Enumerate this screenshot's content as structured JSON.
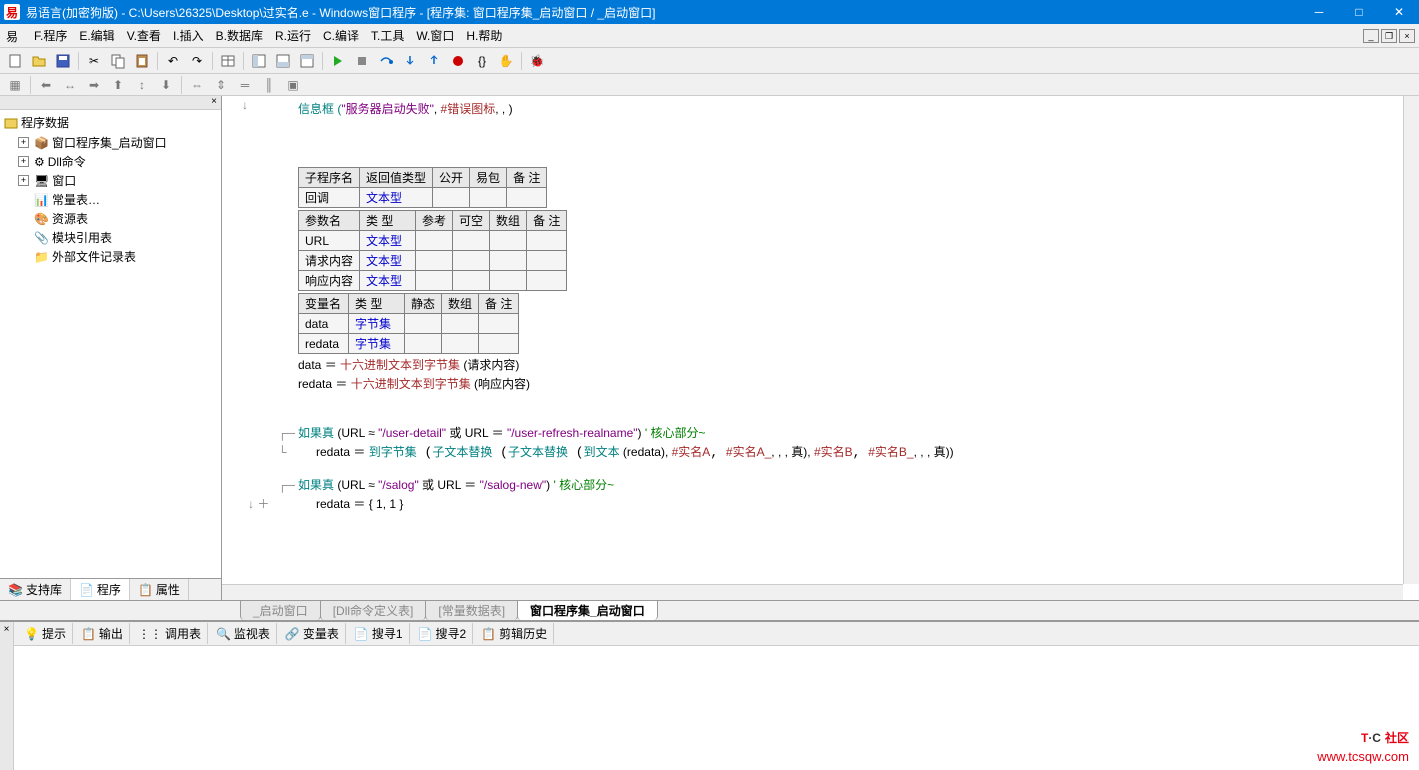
{
  "title": "易语言(加密狗版) - C:\\Users\\26325\\Desktop\\过实名.e - Windows窗口程序 - [程序集: 窗口程序集_启动窗口 / _启动窗口]",
  "logo_char": "易",
  "menu": {
    "file": "F.程序",
    "edit": "E.编辑",
    "view": "V.查看",
    "insert": "I.插入",
    "db": "B.数据库",
    "run": "R.运行",
    "compile": "C.编译",
    "tool": "T.工具",
    "window": "W.窗口",
    "help": "H.帮助"
  },
  "tree": {
    "root": "程序数据",
    "items": [
      {
        "label": "窗口程序集_启动窗口",
        "icon": "module"
      },
      {
        "label": "Dll命令",
        "icon": "dll"
      },
      {
        "label": "窗口",
        "icon": "window"
      },
      {
        "label": "常量表…",
        "icon": "const"
      },
      {
        "label": "资源表",
        "icon": "resource"
      },
      {
        "label": "模块引用表",
        "icon": "ref"
      },
      {
        "label": "外部文件记录表",
        "icon": "file"
      }
    ]
  },
  "lefttabs": {
    "support": "支持库",
    "program": "程序",
    "property": "属性"
  },
  "code": {
    "line1_pre": "信息框 (",
    "line1_str": "\"服务器启动失败\"",
    "line1_mid": ", ",
    "line1_const": "#错误图标",
    "line1_end": ", , )",
    "table1": {
      "headers": [
        "子程序名",
        "返回值类型",
        "公开",
        "易包",
        "备 注"
      ],
      "row": [
        "回调",
        "文本型",
        "",
        "",
        ""
      ]
    },
    "table2": {
      "headers": [
        "参数名",
        "类 型",
        "参考",
        "可空",
        "数组",
        "备 注"
      ],
      "rows": [
        [
          "URL",
          "文本型",
          "",
          "",
          "",
          ""
        ],
        [
          "请求内容",
          "文本型",
          "",
          "",
          "",
          ""
        ],
        [
          "响应内容",
          "文本型",
          "",
          "",
          "",
          ""
        ]
      ]
    },
    "table3": {
      "headers": [
        "变量名",
        "类 型",
        "静态",
        "数组",
        "备 注"
      ],
      "rows": [
        [
          "data",
          "字节集",
          "",
          "",
          ""
        ],
        [
          "redata",
          "字节集",
          "",
          "",
          ""
        ]
      ]
    },
    "l_data_assign": {
      "pre": "data ＝ ",
      "fn": "十六进制文本到字节集",
      "args": " (请求内容)"
    },
    "l_redata_assign": {
      "pre": "redata ＝ ",
      "fn": "十六进制文本到字节集",
      "args": " (响应内容)"
    },
    "if1_pre": "如果真 ",
    "if1_cond_a": "(URL ≈ ",
    "if1_str1": "\"/user-detail\"",
    "if1_or": " 或 URL ＝ ",
    "if1_str2": "\"/user-refresh-realname\"",
    "if1_close": ")",
    "if1_cmt": " ' 核心部分~",
    "if1_body_pre": "redata ＝ ",
    "if1_fn1": "到字节集",
    "if1_fn2": "子文本替换",
    "if1_fn3": "子文本替换",
    "if1_fn4": "到文本",
    "if1_args_inner": " (redata), ",
    "if1_c1": "#实名A",
    "if1_c2": "#实名A_",
    "if1_mid1": ", , , 真), ",
    "if1_c3": "#实名B",
    "if1_c4": "#实名B_",
    "if1_end": ", , , 真))",
    "if2_pre": "如果真 ",
    "if2_cond_a": "(URL ≈ ",
    "if2_str1": "\"/salog\"",
    "if2_or": " 或 URL ＝ ",
    "if2_str2": "\"/salog-new\"",
    "if2_close": ")",
    "if2_cmt": " ' 核心部分~",
    "if2_body": "redata ＝ { 1, 1 }"
  },
  "bottomtabs": {
    "t1": "_启动窗口",
    "t2": "[Dll命令定义表]",
    "t3": "[常量数据表]",
    "t4": "窗口程序集_启动窗口"
  },
  "bptabs": {
    "hint": "提示",
    "output": "输出",
    "call": "调用表",
    "watch": "监视表",
    "var": "变量表",
    "s1": "搜寻1",
    "s2": "搜寻2",
    "hist": "剪辑历史"
  },
  "watermark": {
    "brand_pre": "T",
    "brand_mid": "·C",
    "brand_suf": "社区",
    "url": "www.tcsqw.com"
  }
}
